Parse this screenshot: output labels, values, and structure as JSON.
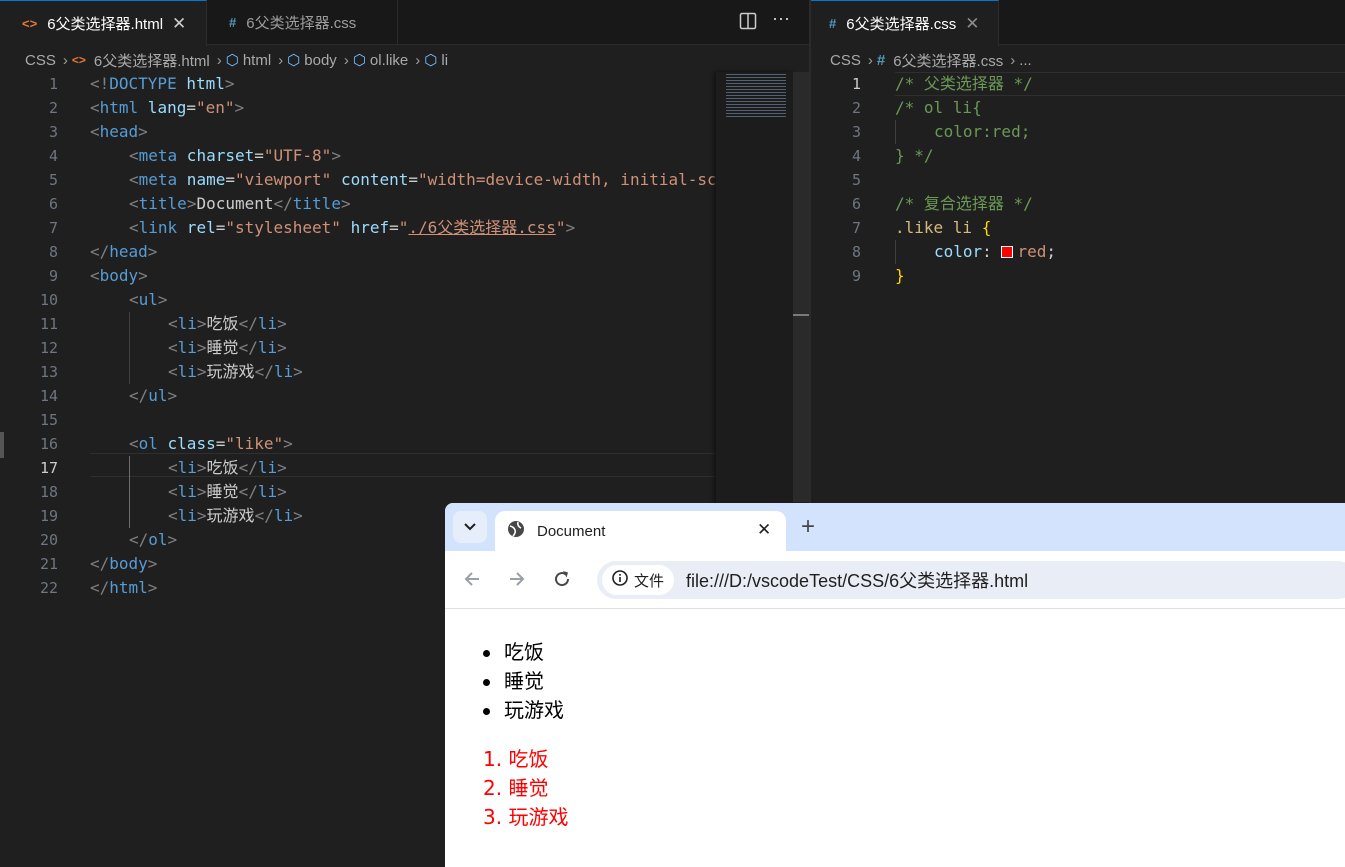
{
  "left_editor": {
    "tabs": [
      {
        "label": "6父类选择器.html",
        "icon": "html-file-icon",
        "active": true
      },
      {
        "label": "6父类选择器.css",
        "icon": "css-file-icon",
        "active": false
      }
    ],
    "breadcrumbs": [
      "CSS",
      "6父类选择器.html",
      "html",
      "body",
      "ol.like",
      "li"
    ],
    "current_line": 17,
    "lines": [
      "1",
      "2",
      "3",
      "4",
      "5",
      "6",
      "7",
      "8",
      "9",
      "10",
      "11",
      "12",
      "13",
      "14",
      "15",
      "16",
      "17",
      "18",
      "19",
      "20",
      "21",
      "22"
    ],
    "code": {
      "l1": {
        "a": "<!",
        "b": "DOCTYPE",
        "c": " html",
        "d": ">"
      },
      "l2": {
        "a": "<",
        "b": "html",
        "c": " lang",
        "d": "=",
        "e": "\"en\"",
        "f": ">"
      },
      "l3": {
        "a": "<",
        "b": "head",
        "c": ">"
      },
      "l4": {
        "a": "<",
        "b": "meta",
        "c": " charset",
        "d": "=",
        "e": "\"UTF-8\"",
        "f": ">"
      },
      "l5": {
        "a": "<",
        "b": "meta",
        "c": " name",
        "d": "=",
        "e": "\"viewport\"",
        "f": " content",
        "g": "=",
        "h": "\"width=device-width, initial-sca"
      },
      "l6": {
        "a": "<",
        "b": "title",
        "c": ">",
        "d": "Document",
        "e": "</",
        "f": "title",
        "g": ">"
      },
      "l7": {
        "a": "<",
        "b": "link",
        "c": " rel",
        "d": "=",
        "e": "\"stylesheet\"",
        "f": " href",
        "g": "=",
        "h": "\"",
        "i": "./6父类选择器.css",
        "j": "\"",
        "k": ">"
      },
      "l8": {
        "a": "</",
        "b": "head",
        "c": ">"
      },
      "l9": {
        "a": "<",
        "b": "body",
        "c": ">"
      },
      "l10": {
        "a": "<",
        "b": "ul",
        "c": ">"
      },
      "l11": {
        "a": "<",
        "b": "li",
        "c": ">",
        "d": "吃饭",
        "e": "</",
        "f": "li",
        "g": ">"
      },
      "l12": {
        "a": "<",
        "b": "li",
        "c": ">",
        "d": "睡觉",
        "e": "</",
        "f": "li",
        "g": ">"
      },
      "l13": {
        "a": "<",
        "b": "li",
        "c": ">",
        "d": "玩游戏",
        "e": "</",
        "f": "li",
        "g": ">"
      },
      "l14": {
        "a": "</",
        "b": "ul",
        "c": ">"
      },
      "l16": {
        "a": "<",
        "b": "ol",
        "c": " class",
        "d": "=",
        "e": "\"like\"",
        "f": ">"
      },
      "l17": {
        "a": "<",
        "b": "li",
        "c": ">",
        "d": "吃饭",
        "e": "</",
        "f": "li",
        "g": ">"
      },
      "l18": {
        "a": "<",
        "b": "li",
        "c": ">",
        "d": "睡觉",
        "e": "</",
        "f": "li",
        "g": ">"
      },
      "l19": {
        "a": "<",
        "b": "li",
        "c": ">",
        "d": "玩游戏",
        "e": "</",
        "f": "li",
        "g": ">"
      },
      "l20": {
        "a": "</",
        "b": "ol",
        "c": ">"
      },
      "l21": {
        "a": "</",
        "b": "body",
        "c": ">"
      },
      "l22": {
        "a": "</",
        "b": "html",
        "c": ">"
      }
    }
  },
  "right_editor": {
    "tab": {
      "label": "6父类选择器.css",
      "icon": "css-file-icon"
    },
    "breadcrumbs": [
      "CSS",
      "6父类选择器.css",
      "..."
    ],
    "current_line": 1,
    "lines": [
      "1",
      "2",
      "3",
      "4",
      "5",
      "6",
      "7",
      "8",
      "9"
    ],
    "code": {
      "l1": "/* 父类选择器 */",
      "l2": "/* ol li{",
      "l3": "color:red;",
      "l4": "} */",
      "l6": "/* 复合选择器 */",
      "l7": {
        "a": ".like li",
        "b": " {"
      },
      "l8": {
        "a": "color",
        "b": ": ",
        "c": "red",
        "d": ";"
      },
      "l9": "}"
    },
    "swatch_color": "#ff0000"
  },
  "browser": {
    "tab_title": "Document",
    "new_tab": "+",
    "close": "✕",
    "info_label": "文件",
    "url": "file:///D:/vscodeTest/CSS/6父类选择器.html",
    "ul_items": [
      "吃饭",
      "睡觉",
      "玩游戏"
    ],
    "ol_items": [
      {
        "num": "1.",
        "text": "吃饭"
      },
      {
        "num": "2.",
        "text": "睡觉"
      },
      {
        "num": "3.",
        "text": "玩游戏"
      }
    ],
    "ol_color": "#ff0000"
  },
  "colors": {
    "editor_bg": "#1f1f1f",
    "tab_bar": "#181818",
    "accent": "#0078d4"
  }
}
